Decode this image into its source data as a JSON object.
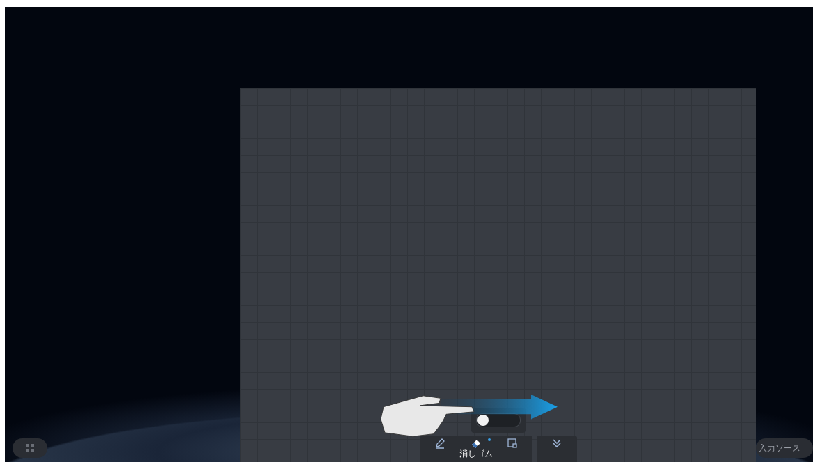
{
  "taskbar": {
    "input_source_button": {
      "label": "入力ソース"
    }
  },
  "whiteboard": {
    "toggle": {
      "on": false
    },
    "tools": [
      {
        "kind": "pen",
        "selected": false
      },
      {
        "kind": "eraser",
        "selected": true,
        "label": "消しゴム"
      },
      {
        "kind": "select",
        "selected": false
      },
      {
        "kind": "collapse",
        "selected": false
      }
    ]
  }
}
